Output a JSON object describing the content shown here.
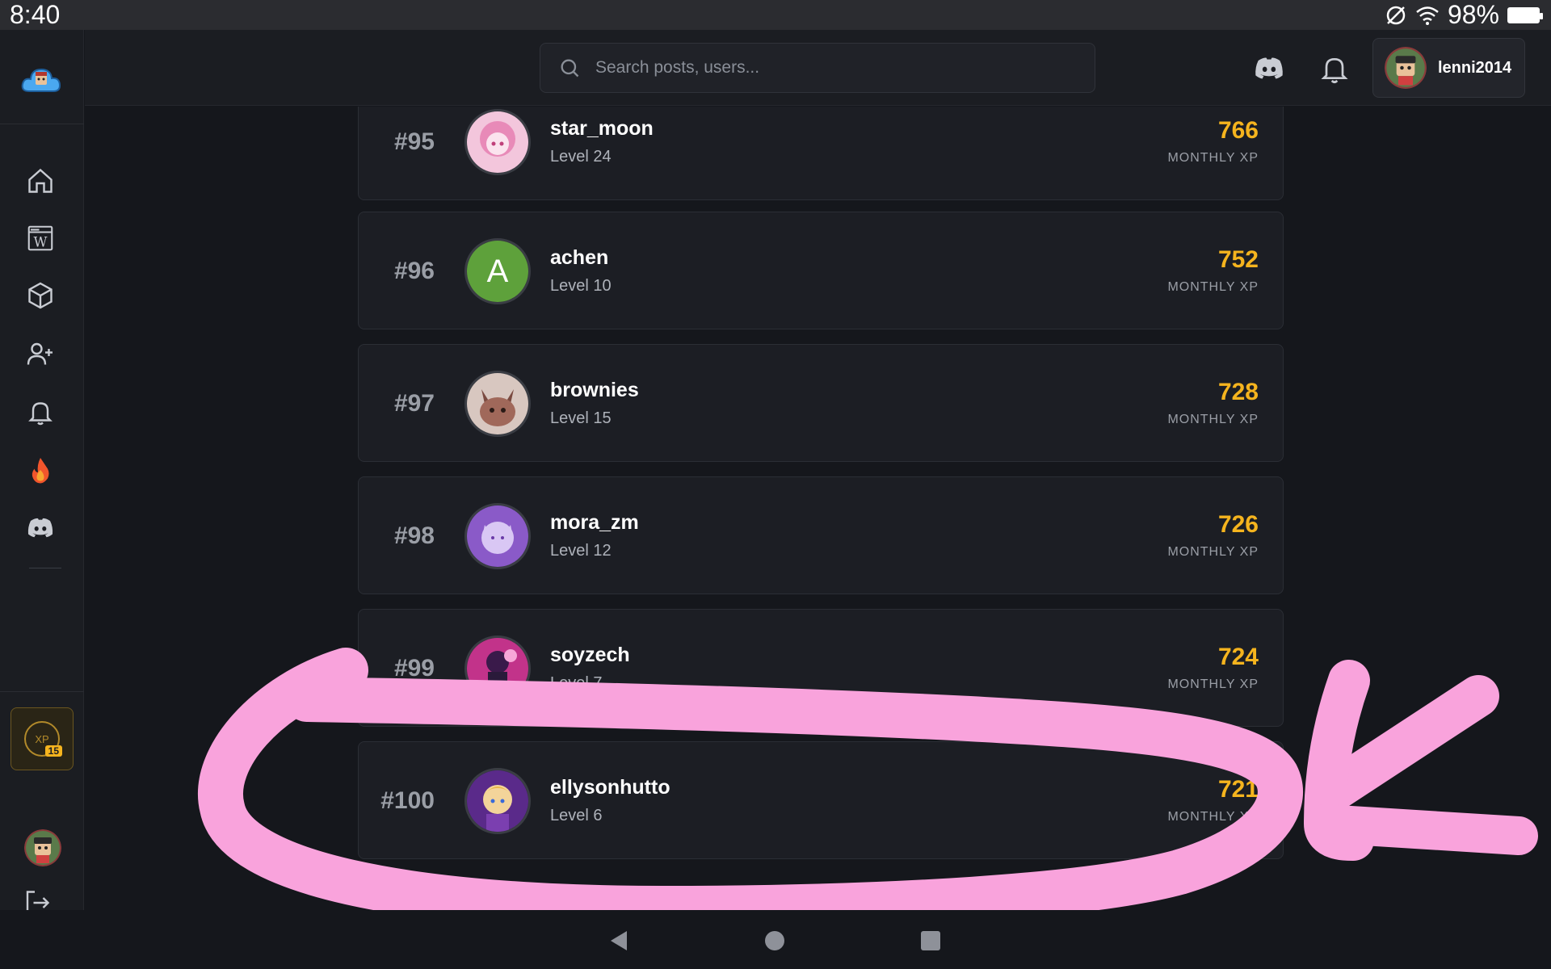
{
  "statusbar": {
    "time": "8:40",
    "battery": "98%"
  },
  "search": {
    "placeholder": "Search posts, users..."
  },
  "user": {
    "name": "lenni2014"
  },
  "xp_badge": {
    "label": "XP",
    "level": "15"
  },
  "leaderboard": {
    "xp_label": "MONTHLY XP",
    "rows": [
      {
        "rank": "#95",
        "username": "star_moon",
        "level": "Level 24",
        "xp": "766",
        "avatar_color": "#e8a6c8"
      },
      {
        "rank": "#96",
        "username": "achen",
        "level": "Level 10",
        "xp": "752",
        "avatar_color": "#5ea13b",
        "avatar_letter": "A"
      },
      {
        "rank": "#97",
        "username": "brownies",
        "level": "Level 15",
        "xp": "728",
        "avatar_color": "#7a4a40"
      },
      {
        "rank": "#98",
        "username": "mora_zm",
        "level": "Level 12",
        "xp": "726",
        "avatar_color": "#9a6ad6"
      },
      {
        "rank": "#99",
        "username": "soyzech",
        "level": "Level 7",
        "xp": "724",
        "avatar_color": "#c2338a"
      },
      {
        "rank": "#100",
        "username": "ellysonhutto",
        "level": "Level 6",
        "xp": "721",
        "avatar_color": "#7b3fb0"
      }
    ]
  },
  "colors": {
    "accent_xp": "#f5b41e",
    "annotation": "#f9a3dc"
  }
}
